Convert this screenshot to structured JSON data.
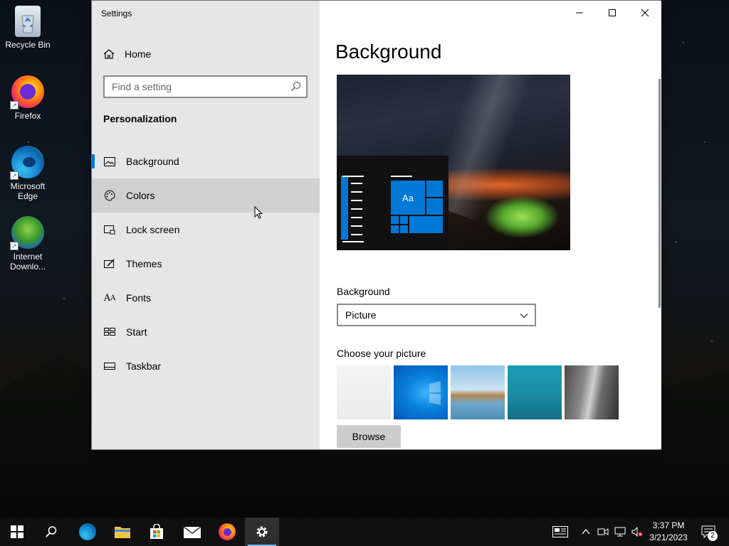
{
  "desktop": {
    "icons": [
      {
        "label": "Recycle Bin"
      },
      {
        "label": "Firefox"
      },
      {
        "label": "Microsoft Edge"
      },
      {
        "label": "Internet Downlo..."
      }
    ]
  },
  "window": {
    "title": "Settings",
    "controls": [
      "minimize",
      "maximize",
      "close"
    ]
  },
  "sidebar": {
    "home_label": "Home",
    "search_placeholder": "Find a setting",
    "section_title": "Personalization",
    "items": [
      {
        "label": "Background",
        "icon": "image-icon",
        "active": true
      },
      {
        "label": "Colors",
        "icon": "palette-icon",
        "hover": true
      },
      {
        "label": "Lock screen",
        "icon": "lock-screen-icon"
      },
      {
        "label": "Themes",
        "icon": "themes-icon"
      },
      {
        "label": "Fonts",
        "icon": "fonts-icon"
      },
      {
        "label": "Start",
        "icon": "start-icon"
      },
      {
        "label": "Taskbar",
        "icon": "taskbar-icon"
      }
    ]
  },
  "content": {
    "heading": "Background",
    "preview_tile_label": "Aa",
    "background_label": "Background",
    "background_value": "Picture",
    "choose_label": "Choose your picture",
    "browse_label": "Browse"
  },
  "taskbar": {
    "apps": [
      "start-icon",
      "search-icon",
      "edge-icon",
      "file-explorer-icon",
      "store-icon",
      "mail-icon",
      "firefox-icon",
      "settings-icon"
    ],
    "time": "3:37 PM",
    "date": "3/21/2023",
    "notification_count": "2"
  },
  "colors": {
    "accent": "#0078d7",
    "sidebar_bg": "#e6e6e6",
    "hover_bg": "#d0d0d0",
    "taskbar_bg": "#101010"
  }
}
